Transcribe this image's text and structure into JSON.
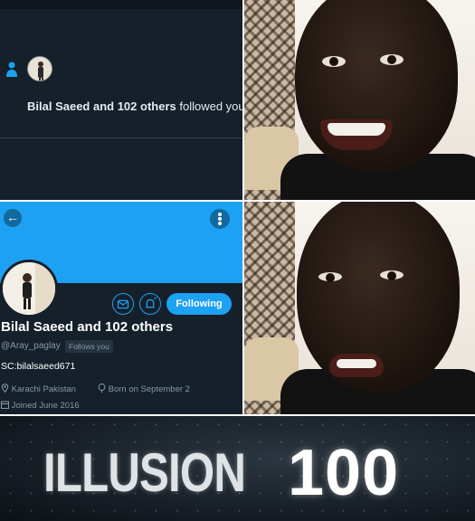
{
  "notification": {
    "text_name": "Bilal Saeed and 102 others",
    "text_rest": "followed you"
  },
  "profile": {
    "back_glyph": "←",
    "name": "Bilal Saeed and 102 others",
    "handle": "@Aray_paglay",
    "follows_you": "Follows you",
    "follow_button": "Following",
    "bio": "SC:bilalsaeed671",
    "location": "Karachi Pakistan",
    "birthday": "Born on September 2",
    "joined": "Joined June 2016",
    "icons": [
      "back-arrow-icon",
      "more-options-icon",
      "message-icon",
      "notification-bell-icon",
      "location-pin-icon",
      "balloon-icon",
      "calendar-icon"
    ]
  },
  "caption": {
    "word": "ILLUSION",
    "number": "100"
  },
  "colors": {
    "twitter_blue": "#1da1f2",
    "dark_background": "#15202b",
    "muted_text": "#8899a6"
  }
}
